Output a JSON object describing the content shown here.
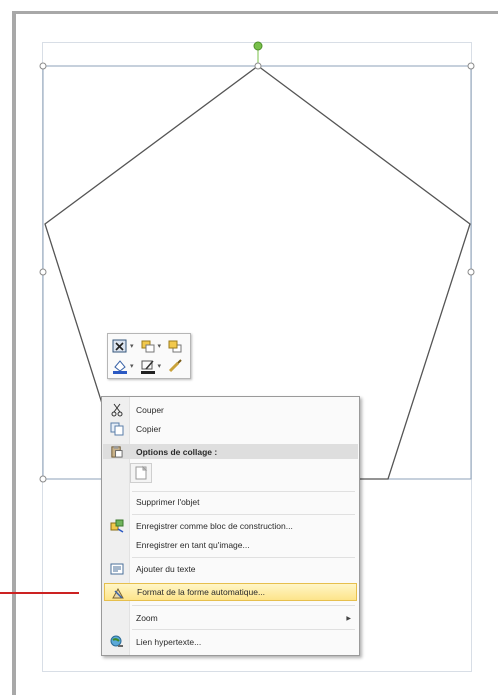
{
  "colors": {
    "page_border": "#a8a8a8",
    "shape_outline": "#555555",
    "selection_frame": "#8ea1b8",
    "rotation_handle": "#78c04a",
    "menu_highlight": "#fde48a",
    "callout": "#cc2222"
  },
  "mini_toolbar": {
    "row1": [
      "text-wrap-icon",
      "bring-forward-icon",
      "send-backward-icon"
    ],
    "row2": [
      "shape-fill-icon",
      "shape-outline-icon",
      "format-painter-icon"
    ]
  },
  "context_menu": {
    "cut": "Couper",
    "copy": "Copier",
    "paste_options_header": "Options de collage :",
    "delete_object": "Supprimer l'objet",
    "save_as_building_block": "Enregistrer comme bloc de construction...",
    "save_as_image": "Enregistrer en tant qu'image...",
    "add_text": "Ajouter du texte",
    "format_autoshape": "Format de la forme automatique...",
    "zoom": "Zoom",
    "hyperlink": "Lien hypertexte..."
  }
}
